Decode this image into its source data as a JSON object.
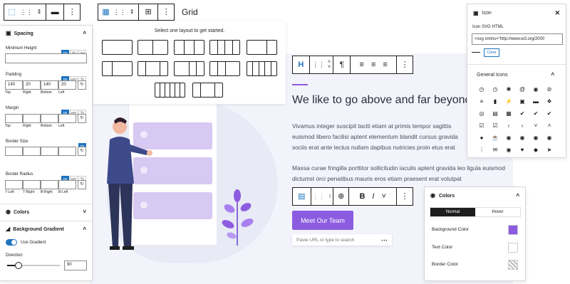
{
  "grid_toolbar": {
    "title": "Grid"
  },
  "layout_picker": {
    "prompt": "Select one layout to get started."
  },
  "spacing": {
    "title": "Spacing",
    "min_height": {
      "label": "Minimum Height",
      "units": [
        "px",
        "vh",
        "vw"
      ]
    },
    "padding": {
      "label": "Padding",
      "units": [
        "px",
        "em",
        "%"
      ],
      "values": [
        "140",
        "20",
        "140",
        "20"
      ],
      "sides": [
        "Top",
        "Right",
        "Bottom",
        "Left"
      ]
    },
    "margin": {
      "label": "Margin",
      "units": [
        "px",
        "em",
        "%"
      ],
      "sides": [
        "Top",
        "Right",
        "Bottom",
        "Left"
      ]
    },
    "border_size": {
      "label": "Border Size",
      "units": [
        "px"
      ]
    },
    "border_radius": {
      "label": "Border Radius",
      "units": [
        "px",
        "em",
        "%"
      ],
      "corners": [
        "T-Left",
        "T-Right",
        "B-Right",
        "B-Left"
      ]
    }
  },
  "colors_left": {
    "title": "Colors"
  },
  "bg_gradient": {
    "title": "Background Gradient",
    "use_label": "Use Gradient",
    "direction_label": "Direction",
    "direction_value": "90",
    "direction_fraction": 0.22
  },
  "content": {
    "heading": "We like to go above and far beyond",
    "p1": "Vivamus integer suscipit taciti etiam at primis tempor sagittis euismod libero facilisi aptent elementum blandit cursus gravida sociis erat ante lectus nullam dapibus nutricies proin etus erat ante feugiat cursus",
    "p2": "Massa curae fringilla porttitor sollicitudin iaculis aptent gravida leo ligula euismod dictumst orci penatibus mauris eros etiam praesent erat volutpat",
    "button": "Meet Our Team",
    "url_placeholder": "Paste URL or type to search"
  },
  "icon_panel": {
    "title": "Icon",
    "svg_label": "Icon SVG HTML",
    "svg_value": "<svg xmlns=\"http://www.w3.org/2000",
    "clear": "Clear",
    "general_title": "General Icons",
    "icons": [
      "◷",
      "◷",
      "✱",
      "@",
      "◉",
      "⊘",
      "≡",
      "▮",
      "⚡",
      "▣",
      "▬",
      "❖",
      "◎",
      "▤",
      "▦",
      "✔",
      "✔",
      "✔",
      "☑",
      "☑",
      "‹",
      "›",
      "˅",
      "˄",
      "●",
      "☕",
      "◉",
      "◉",
      "◉",
      "◉",
      "⋮",
      "✉",
      "◉",
      "♥",
      "◆",
      "➤"
    ]
  },
  "colors_panel": {
    "title": "Colors",
    "tabs": [
      "Normal",
      "Hover"
    ],
    "rows": [
      {
        "label": "Background Color",
        "color": "#8c5ce0"
      },
      {
        "label": "Text Color",
        "color": "#ffffff"
      },
      {
        "label": "Border Color",
        "color": "pattern"
      }
    ]
  },
  "accent": "#8c5ce0"
}
